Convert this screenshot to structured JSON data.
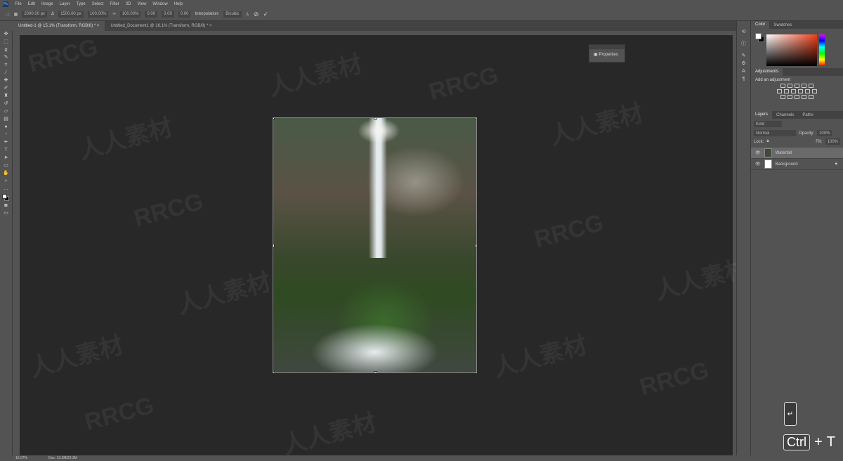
{
  "menu": {
    "items": [
      "File",
      "Edit",
      "Image",
      "Layer",
      "Type",
      "Select",
      "Filter",
      "3D",
      "View",
      "Window",
      "Help"
    ],
    "logo": "Ps"
  },
  "options": {
    "x": "2000.00 px",
    "y": "1500.00 px",
    "w": "100.00%",
    "h": "100.00%",
    "angle": "0.00",
    "hskew": "0.00",
    "vskew": "0.00",
    "interp_label": "Interpolation:",
    "interp": "Bicubic"
  },
  "tabs": [
    {
      "label": "Untitled-1 @ 15.1% (Transform, RGB/8) *"
    },
    {
      "label": "Untitled_Document1 @ 16.1% (Transform, RGB/8) *"
    }
  ],
  "properties_panel": {
    "label": "Properties"
  },
  "panels": {
    "color_tab": "Color",
    "swatches_tab": "Swatches",
    "adjustments_tab": "Adjustments",
    "adjust_hint": "Add an adjustment",
    "layers_tab": "Layers",
    "channels_tab": "Channels",
    "paths_tab": "Paths",
    "kind": "Kind",
    "blend": "Normal",
    "opacity_label": "Opacity:",
    "opacity": "100%",
    "lock_label": "Lock:",
    "fill_label": "Fill:",
    "fill": "100%",
    "layers": [
      {
        "name": "Waterfall"
      },
      {
        "name": "Background"
      }
    ]
  },
  "status": {
    "zoom": "15.07%",
    "doc": "Doc: 13.3M/23.3M"
  },
  "keys": {
    "enter": "↵",
    "ctrl": "Ctrl",
    "plus": "+",
    "t": "T"
  },
  "watermarks": [
    "RRCG",
    "人人素材"
  ]
}
